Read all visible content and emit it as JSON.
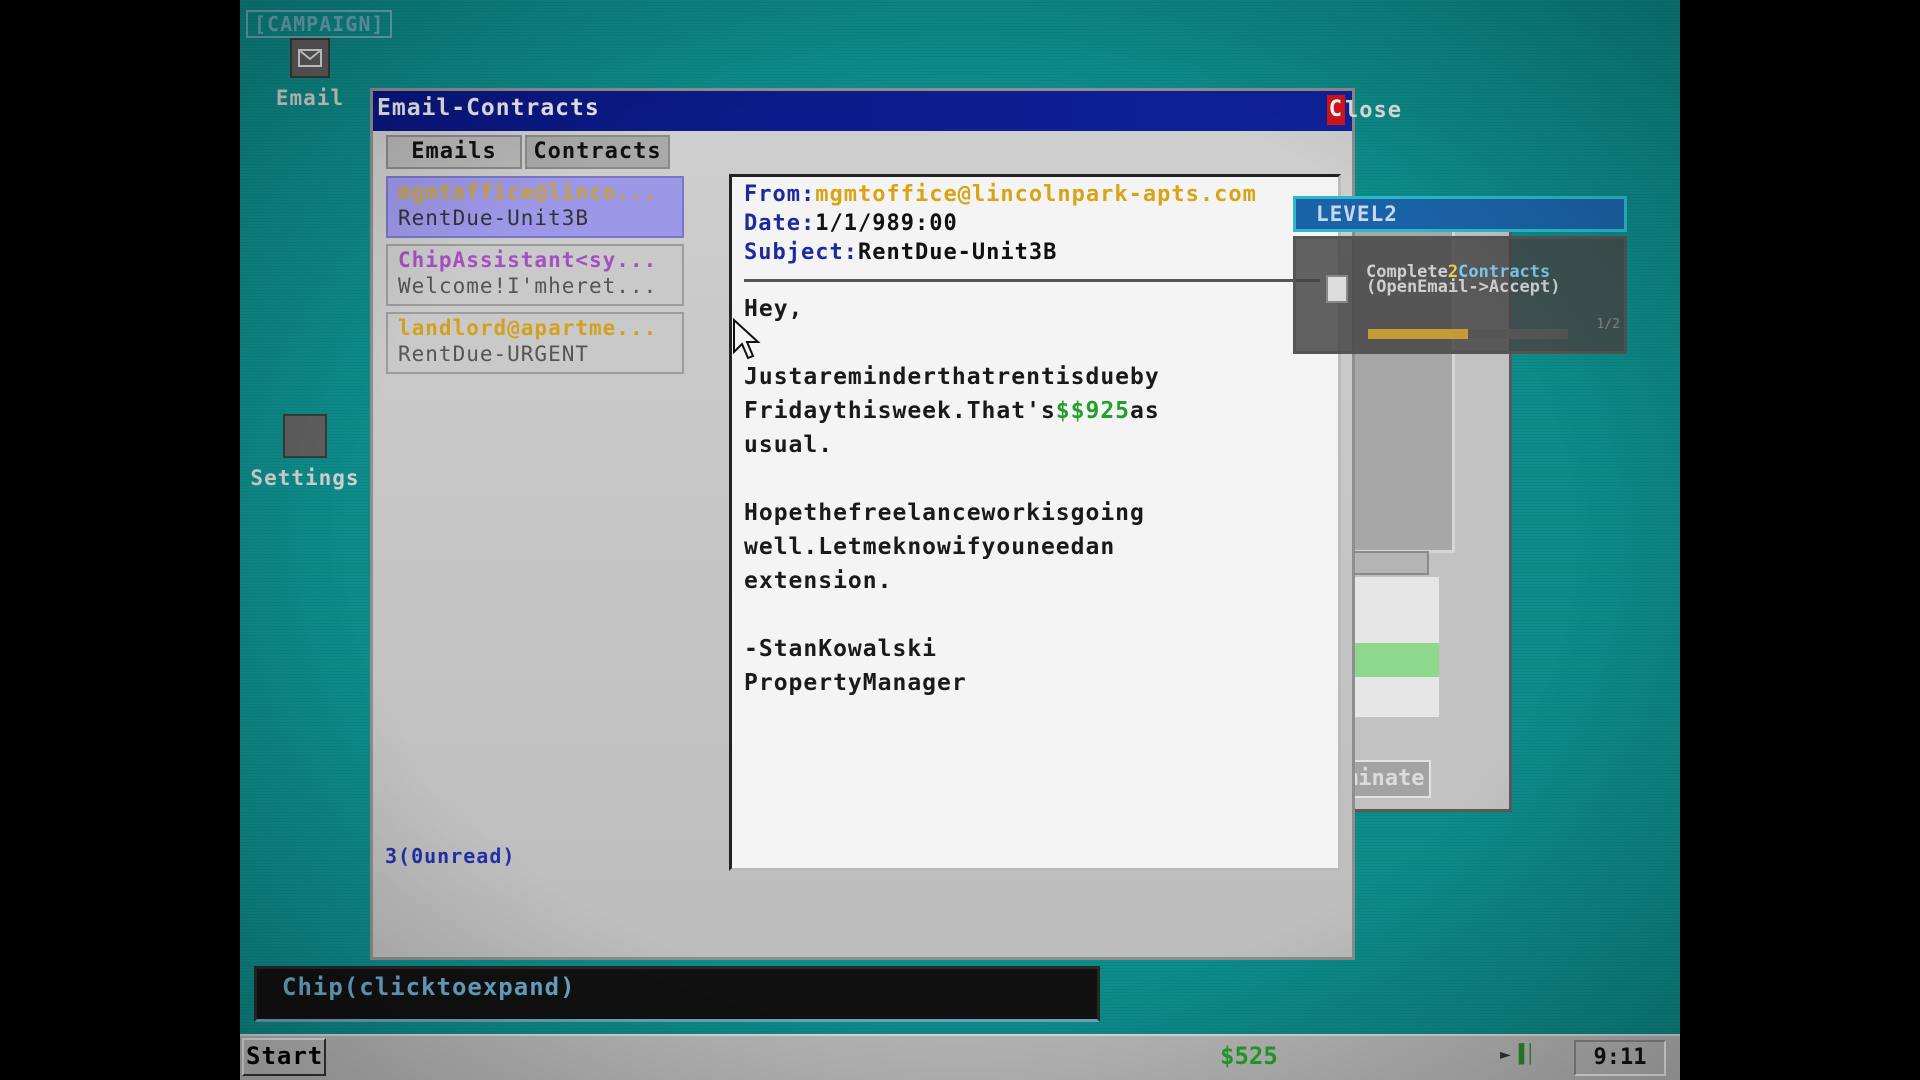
{
  "desktop": {
    "campaign_label": "[CAMPAIGN]",
    "icons": [
      {
        "label": "Email",
        "icon": "envelope-icon"
      },
      {
        "label": "Settings",
        "icon": "settings-icon"
      }
    ]
  },
  "window": {
    "title": "Email-Contracts",
    "close_x": "C",
    "close_rest": "lose",
    "tabs": [
      {
        "label": "Emails",
        "active": true
      },
      {
        "label": "Contracts",
        "active": false
      }
    ],
    "emails": [
      {
        "from": "mgmtoffice@linco...",
        "subject": "RentDue-Unit3B",
        "selected": true
      },
      {
        "from": "ChipAssistant<sy...",
        "subject": "Welcome!I'mheret...",
        "selected": false
      },
      {
        "from": "landlord@apartme...",
        "subject": "RentDue-URGENT",
        "selected": false
      }
    ],
    "unread_label": "3(0unread)"
  },
  "reader": {
    "from_key": "From:",
    "from_value": "mgmtoffice@lincolnpark-apts.com",
    "date_key": "Date:",
    "date_value": "1/1/989:00",
    "subject_key": "Subject:",
    "subject_value": "RentDue-Unit3B",
    "body": {
      "greeting": "Hey,",
      "p1_line1": "Justareminderthatrentisdueby",
      "p1_line2_a": "Fridaythisweek.That's",
      "p1_amount": "$$925",
      "p1_line2_b": "as",
      "p1_line3": "usual.",
      "p2_line1": "Hopethefreelanceworkisgoing",
      "p2_line2": "well.Letmeknowifyouneedan",
      "p2_line3": "extension.",
      "sig1": "-StanKowalski",
      "sig2": "PropertyManager"
    }
  },
  "background_window": {
    "terminate_label": "minate"
  },
  "level": {
    "label": "LEVEL2",
    "quest_pre": "Complete",
    "quest_num": "2",
    "quest_word": "Contracts",
    "quest_hint": "(OpenEmail->Accept)",
    "progress_fraction": 0.5,
    "progress_text": "1/2"
  },
  "chip": {
    "label": "Chip(clicktoexpand)"
  },
  "taskbar": {
    "start_label": "Start",
    "balance": "$525",
    "clock": "9:11",
    "tray_icons": [
      "volume-icon",
      "network-icon"
    ]
  },
  "colors": {
    "desktop": "#0d8c8a",
    "titlebar": "#0a1a8c",
    "money": "#24a02a",
    "close_red": "#d4141c"
  }
}
